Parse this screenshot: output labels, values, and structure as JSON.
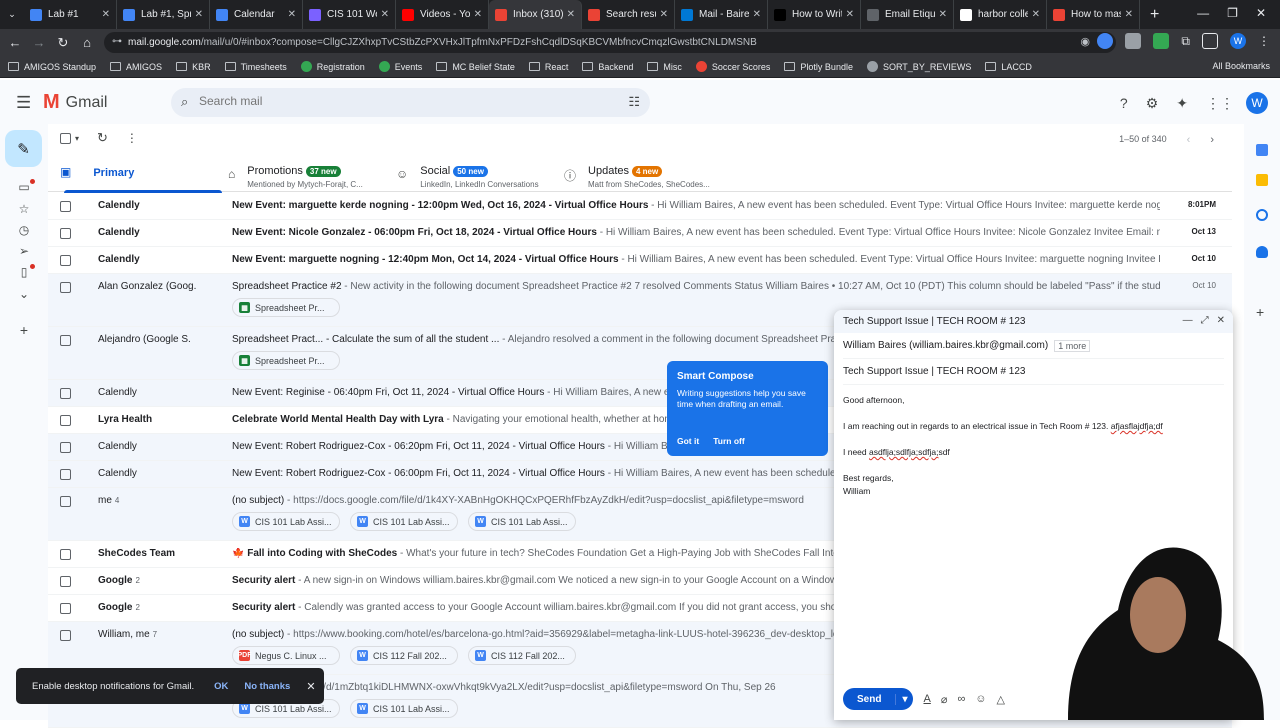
{
  "tabs": [
    {
      "label": "Lab #1",
      "color": "#4285f4"
    },
    {
      "label": "Lab #1, Spre",
      "color": "#4285f4"
    },
    {
      "label": "Calendar",
      "color": "#4285f4"
    },
    {
      "label": "CIS 101 Wee",
      "color": "#7b61ff"
    },
    {
      "label": "Videos - You",
      "color": "#ff0000"
    },
    {
      "label": "Inbox (310)",
      "color": "#ea4335"
    },
    {
      "label": "Search resul",
      "color": "#ea4335"
    },
    {
      "label": "Mail - Baires",
      "color": "#0078d4"
    },
    {
      "label": "How to Writ",
      "color": "#000000"
    },
    {
      "label": "Email Etique",
      "color": "#5f6368"
    },
    {
      "label": "harbor colle",
      "color": "#ffffff"
    },
    {
      "label": "How to mas",
      "color": "#ea4335"
    }
  ],
  "url": {
    "domain": "mail.google.com",
    "path": "/mail/u/0/#inbox?compose=CllgCJZXhxpTvCStbZcPXVHxJlTpfmNxPFDzFshCqdlDSqKBCVMbfncvCmqzlGwstbtCNLDMSNB"
  },
  "bookmarks": [
    "AMIGOS Standup",
    "AMIGOS",
    "KBR",
    "Timesheets",
    "Registration",
    "Events",
    "MC Belief State",
    "React",
    "Backend",
    "Misc",
    "Soccer Scores",
    "Plotly Bundle",
    "SORT_BY_REVIEWS",
    "LACCD"
  ],
  "all_bookmarks": "All Bookmarks",
  "app": {
    "name": "Gmail",
    "search_placeholder": "Search mail",
    "avatar": "W"
  },
  "pager": "1–50 of 340",
  "inbox_tabs": [
    {
      "label": "Primary"
    },
    {
      "label": "Promotions",
      "badge": "37 new",
      "badge_color": "#188038",
      "sub": "Mentioned by Mytych-Forajt, C..."
    },
    {
      "label": "Social",
      "badge": "50 new",
      "badge_color": "#1a73e8",
      "sub": "LinkedIn, LinkedIn Conversations"
    },
    {
      "label": "Updates",
      "badge": "4 new",
      "badge_color": "#e37400",
      "sub": "Matt from SheCodes, SheCodes..."
    }
  ],
  "emails": [
    {
      "from": "Calendly",
      "count": "",
      "subject": "New Event: marguette kerde nogning - 12:00pm Wed, Oct 16, 2024 - Virtual Office Hours",
      "snippet": " - Hi William Baires, A new event has been scheduled. Event Type: Virtual Office Hours Invitee: marguette kerde nogning Invit...",
      "date": "8:01PM",
      "unread": true,
      "chips": []
    },
    {
      "from": "Calendly",
      "count": "",
      "subject": "New Event: Nicole Gonzalez - 06:00pm Fri, Oct 18, 2024 - Virtual Office Hours",
      "snippet": " - Hi William Baires, A new event has been scheduled. Event Type: Virtual Office Hours Invitee: Nicole Gonzalez Invitee Email: nicmgonza...",
      "date": "Oct 13",
      "unread": true,
      "chips": []
    },
    {
      "from": "Calendly",
      "count": "",
      "subject": "New Event: marguette nogning - 12:40pm Mon, Oct 14, 2024 - Virtual Office Hours",
      "snippet": " - Hi William Baires, A new event has been scheduled. Event Type: Virtual Office Hours Invitee: marguette nogning Invitee Email: ma...",
      "date": "Oct 10",
      "unread": true,
      "chips": []
    },
    {
      "from": "Alan Gonzalez (Goog.",
      "count": "",
      "subject": "Spreadsheet Practice #2",
      "snippet": " - New activity in the following document Spreadsheet Practice #2 7 resolved Comments Status William Baires • 10:27 AM, Oct 10 (PDT) This column should be labeled \"Pass\" if the student has an",
      "date": "Oct 10",
      "unread": false,
      "chips": [
        {
          "label": "Spreadsheet Pr...",
          "type": "sheet"
        }
      ]
    },
    {
      "from": "Alejandro (Google S.",
      "count": "",
      "subject": "Spreadsheet Pract... - Calculate the sum of all the student ...",
      "snippet": " - Alejandro resolved a comment in the following document Spreadsheet Practice",
      "date": "",
      "unread": false,
      "chips": [
        {
          "label": "Spreadsheet Pr...",
          "type": "sheet"
        }
      ]
    },
    {
      "from": "Calendly",
      "count": "",
      "subject": "New Event: Reginise - 06:40pm Fri, Oct 11, 2024 - Virtual Office Hours",
      "snippet": " - Hi William Baires, A new event h",
      "date": "",
      "unread": false,
      "chips": []
    },
    {
      "from": "Lyra Health",
      "count": "",
      "subject": "Celebrate World Mental Health Day with Lyra",
      "snippet": " - Navigating your emotional health, whether at home o",
      "date": "",
      "unread": true,
      "chips": []
    },
    {
      "from": "Calendly",
      "count": "",
      "subject": "New Event: Robert Rodriguez-Cox - 06:20pm Fri, Oct 11, 2024 - Virtual Office Hours",
      "snippet": " - Hi William Baires,",
      "date": "",
      "unread": false,
      "chips": []
    },
    {
      "from": "Calendly",
      "count": "",
      "subject": "New Event: Robert Rodriguez-Cox - 06:00pm Fri, Oct 11, 2024 - Virtual Office Hours",
      "snippet": " - Hi William Baires, A new event has been scheduled. Even",
      "date": "",
      "unread": false,
      "chips": []
    },
    {
      "from": "me",
      "count": "4",
      "subject": "(no subject)",
      "snippet": " - https://docs.google.com/file/d/1k4XY-XABnHgOKHQCxPQERhfFbzAyZdkH/edit?usp=docslist_api&filetype=msword",
      "date": "",
      "unread": false,
      "chips": [
        {
          "label": "CIS 101 Lab Assi...",
          "type": "doc"
        },
        {
          "label": "CIS 101 Lab Assi...",
          "type": "doc"
        },
        {
          "label": "CIS 101 Lab Assi...",
          "type": "doc"
        }
      ]
    },
    {
      "from": "SheCodes Team",
      "count": "",
      "subject": "🍁 Fall into Coding with SheCodes",
      "snippet": " - What's your future in tech? SheCodes Foundation Get a High-Paying Job with SheCodes Fall Into Coding",
      "date": "",
      "unread": true,
      "chips": []
    },
    {
      "from": "Google",
      "count": "2",
      "subject": "Security alert",
      "snippet": " - A new sign-in on Windows william.baires.kbr@gmail.com We noticed a new sign-in to your Google Account on a Windows devi",
      "date": "",
      "unread": true,
      "chips": []
    },
    {
      "from": "Google",
      "count": "2",
      "subject": "Security alert",
      "snippet": " - Calendly was granted access to your Google Account william.baires.kbr@gmail.com If you did not grant access, you should ch",
      "date": "",
      "unread": true,
      "chips": []
    },
    {
      "from": "William, me",
      "count": "7",
      "subject": "(no subject)",
      "snippet": " - https://www.booking.com/hotel/es/barcelona-go.html?aid=356929&label=metagha-link-LUUS-hotel-396236_dev-desktop_los-3",
      "date": "",
      "unread": false,
      "chips": [
        {
          "label": "Negus C. Linux ...",
          "type": "pdf"
        },
        {
          "label": "CIS 112 Fall 202...",
          "type": "doc"
        },
        {
          "label": "CIS 112 Fall 202...",
          "type": "doc"
        }
      ]
    },
    {
      "from": "",
      "count": "",
      "subject": "",
      "snippet": "docs.google.com/file/d/1mZbtq1kiDLHMWNX-oxwVhkqt9kVya2LX/edit?usp=docslist_api&filetype=msword On Thu, Sep 26",
      "date": "",
      "unread": false,
      "chips": [
        {
          "label": "CIS 101 Lab Assi...",
          "type": "doc"
        },
        {
          "label": "CIS 101 Lab Assi...",
          "type": "doc"
        }
      ]
    }
  ],
  "compose": {
    "title": "Tech Support Issue | TECH ROOM # 123",
    "to": "William Baires (william.baires.kbr@gmail.com)",
    "to_more": "1 more",
    "subject": "Tech Support Issue | TECH ROOM # 123",
    "greeting": "Good afternoon,",
    "line1": "I am reaching out in regards to an electrical issue in Tech Room # 123.",
    "line1_typo": "afjasflajdfja;df",
    "line2_prefix": "I need ",
    "line2_typo": "asdflja;sdlfja;sdfja;",
    "line2_suffix": "sdf",
    "closing": "Best regards,",
    "signature": "William",
    "send_label": "Send"
  },
  "smart_compose": {
    "title": "Smart Compose",
    "body": "Writing suggestions help you save time when drafting an email.",
    "got_it": "Got it",
    "turn_off": "Turn off"
  },
  "snackbar": {
    "text": "Enable desktop notifications for Gmail.",
    "ok": "OK",
    "no_thanks": "No thanks"
  }
}
